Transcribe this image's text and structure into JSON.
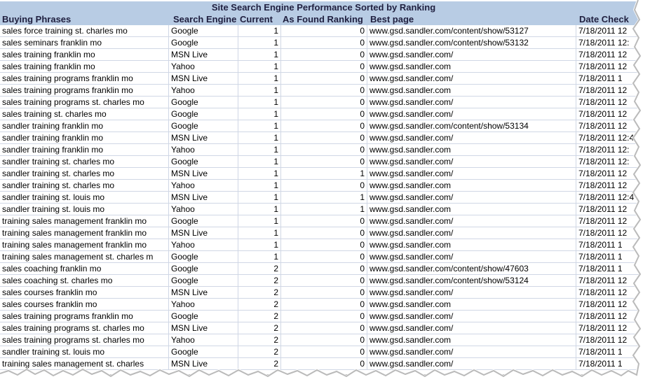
{
  "title": "Site Search Engine Performance Sorted by Ranking",
  "headers": {
    "phrase": "Buying Phrases",
    "engine": "Search Engine",
    "current": "Current",
    "found": "As Found Ranking",
    "page": "Best page",
    "date": "Date Check"
  },
  "rows": [
    {
      "phrase": "sales force training st. charles mo",
      "engine": "Google",
      "current": "1",
      "found": "0",
      "page": "www.gsd.sandler.com/content/show/53127",
      "date": "7/18/2011 12"
    },
    {
      "phrase": "sales seminars franklin mo",
      "engine": "Google",
      "current": "1",
      "found": "0",
      "page": "www.gsd.sandler.com/content/show/53132",
      "date": "7/18/2011 12:"
    },
    {
      "phrase": "sales training franklin mo",
      "engine": "MSN Live",
      "current": "1",
      "found": "0",
      "page": "www.gsd.sandler.com/",
      "date": "7/18/2011 12"
    },
    {
      "phrase": "sales training franklin mo",
      "engine": "Yahoo",
      "current": "1",
      "found": "0",
      "page": "www.gsd.sandler.com",
      "date": "7/18/2011 12"
    },
    {
      "phrase": "sales training programs franklin mo",
      "engine": "MSN Live",
      "current": "1",
      "found": "0",
      "page": "www.gsd.sandler.com/",
      "date": "7/18/2011 1"
    },
    {
      "phrase": "sales training programs franklin mo",
      "engine": "Yahoo",
      "current": "1",
      "found": "0",
      "page": "www.gsd.sandler.com",
      "date": "7/18/2011 12"
    },
    {
      "phrase": "sales training programs st. charles mo",
      "engine": "Google",
      "current": "1",
      "found": "0",
      "page": "www.gsd.sandler.com/",
      "date": "7/18/2011 12"
    },
    {
      "phrase": "sales training st. charles mo",
      "engine": "Google",
      "current": "1",
      "found": "0",
      "page": "www.gsd.sandler.com/",
      "date": "7/18/2011 12"
    },
    {
      "phrase": "sandler training franklin mo",
      "engine": "Google",
      "current": "1",
      "found": "0",
      "page": "www.gsd.sandler.com/content/show/53134",
      "date": "7/18/2011 12"
    },
    {
      "phrase": "sandler training franklin mo",
      "engine": "MSN Live",
      "current": "1",
      "found": "0",
      "page": "www.gsd.sandler.com/",
      "date": "7/18/2011 12:4"
    },
    {
      "phrase": "sandler training franklin mo",
      "engine": "Yahoo",
      "current": "1",
      "found": "0",
      "page": "www.gsd.sandler.com",
      "date": "7/18/2011 12:"
    },
    {
      "phrase": "sandler training st. charles mo",
      "engine": "Google",
      "current": "1",
      "found": "0",
      "page": "www.gsd.sandler.com/",
      "date": "7/18/2011 12:"
    },
    {
      "phrase": "sandler training st. charles mo",
      "engine": "MSN Live",
      "current": "1",
      "found": "1",
      "page": "www.gsd.sandler.com/",
      "date": "7/18/2011 12"
    },
    {
      "phrase": "sandler training st. charles mo",
      "engine": "Yahoo",
      "current": "1",
      "found": "0",
      "page": "www.gsd.sandler.com",
      "date": "7/18/2011 12"
    },
    {
      "phrase": "sandler training st. louis mo",
      "engine": "MSN Live",
      "current": "1",
      "found": "1",
      "page": "www.gsd.sandler.com/",
      "date": "7/18/2011 12:4"
    },
    {
      "phrase": "sandler training st. louis mo",
      "engine": "Yahoo",
      "current": "1",
      "found": "1",
      "page": "www.gsd.sandler.com",
      "date": "7/18/2011 12"
    },
    {
      "phrase": "training sales management franklin mo",
      "engine": "Google",
      "current": "1",
      "found": "0",
      "page": "www.gsd.sandler.com/",
      "date": "7/18/2011 12"
    },
    {
      "phrase": "training sales management franklin mo",
      "engine": "MSN Live",
      "current": "1",
      "found": "0",
      "page": "www.gsd.sandler.com/",
      "date": "7/18/2011 12"
    },
    {
      "phrase": "training sales management franklin mo",
      "engine": "Yahoo",
      "current": "1",
      "found": "0",
      "page": "www.gsd.sandler.com",
      "date": "7/18/2011 1"
    },
    {
      "phrase": "training sales management st. charles m",
      "engine": "Google",
      "current": "1",
      "found": "0",
      "page": "www.gsd.sandler.com/",
      "date": "7/18/2011 1"
    },
    {
      "phrase": "sales coaching franklin mo",
      "engine": "Google",
      "current": "2",
      "found": "0",
      "page": "www.gsd.sandler.com/content/show/47603",
      "date": "7/18/2011 1"
    },
    {
      "phrase": "sales coaching st. charles mo",
      "engine": "Google",
      "current": "2",
      "found": "0",
      "page": "www.gsd.sandler.com/content/show/53124",
      "date": "7/18/2011 12"
    },
    {
      "phrase": "sales courses franklin mo",
      "engine": "MSN Live",
      "current": "2",
      "found": "0",
      "page": "www.gsd.sandler.com/",
      "date": "7/18/2011 12"
    },
    {
      "phrase": "sales courses franklin mo",
      "engine": "Yahoo",
      "current": "2",
      "found": "0",
      "page": "www.gsd.sandler.com",
      "date": "7/18/2011 12"
    },
    {
      "phrase": "sales training programs franklin mo",
      "engine": "Google",
      "current": "2",
      "found": "0",
      "page": "www.gsd.sandler.com/",
      "date": "7/18/2011 12"
    },
    {
      "phrase": "sales training programs st. charles mo",
      "engine": "MSN Live",
      "current": "2",
      "found": "0",
      "page": "www.gsd.sandler.com/",
      "date": "7/18/2011 12"
    },
    {
      "phrase": "sales training programs st. charles mo",
      "engine": "Yahoo",
      "current": "2",
      "found": "0",
      "page": "www.gsd.sandler.com",
      "date": "7/18/2011 12"
    },
    {
      "phrase": "sandler training st. louis mo",
      "engine": "Google",
      "current": "2",
      "found": "0",
      "page": "www.gsd.sandler.com/",
      "date": "7/18/2011 1"
    },
    {
      "phrase": "training sales management st. charles",
      "engine": "MSN Live",
      "current": "2",
      "found": "0",
      "page": "www.gsd.sandler.com/",
      "date": "7/18/2011 1"
    }
  ],
  "colors": {
    "header_fill": "#b8cce4",
    "gridline": "#d0d7e5",
    "shadow": "#7f7f7f"
  }
}
